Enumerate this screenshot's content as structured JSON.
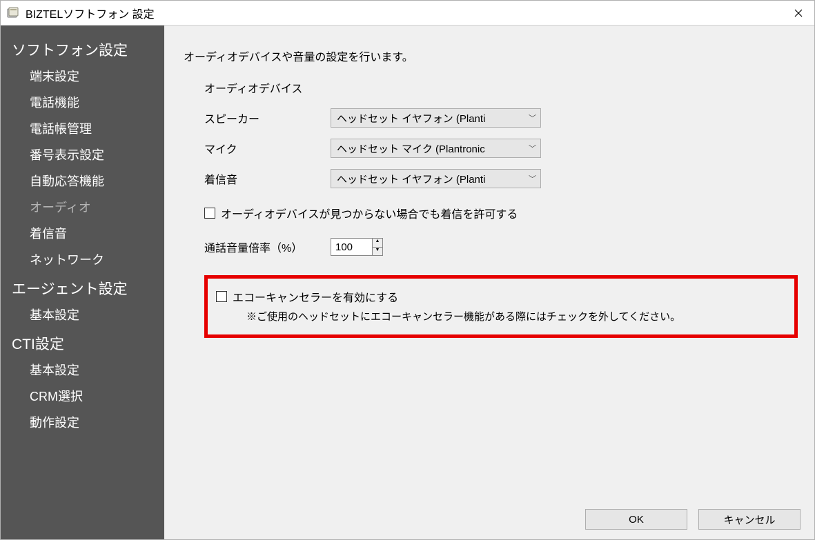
{
  "window": {
    "title": "BIZTELソフトフォン 設定"
  },
  "sidebar": {
    "sections": [
      {
        "title": "ソフトフォン設定",
        "items": [
          {
            "label": "端末設定",
            "active": false
          },
          {
            "label": "電話機能",
            "active": false
          },
          {
            "label": "電話帳管理",
            "active": false
          },
          {
            "label": "番号表示設定",
            "active": false
          },
          {
            "label": "自動応答機能",
            "active": false
          },
          {
            "label": "オーディオ",
            "active": true
          },
          {
            "label": "着信音",
            "active": false
          },
          {
            "label": "ネットワーク",
            "active": false
          }
        ]
      },
      {
        "title": "エージェント設定",
        "items": [
          {
            "label": "基本設定",
            "active": false
          }
        ]
      },
      {
        "title": "CTI設定",
        "items": [
          {
            "label": "基本設定",
            "active": false
          },
          {
            "label": "CRM選択",
            "active": false
          },
          {
            "label": "動作設定",
            "active": false
          }
        ]
      }
    ]
  },
  "main": {
    "heading": "オーディオデバイスや音量の設定を行います。",
    "audio_device_heading": "オーディオデバイス",
    "speaker_label": "スピーカー",
    "speaker_value": "ヘッドセット イヤフォン (Planti",
    "mic_label": "マイク",
    "mic_value": "ヘッドセット マイク (Plantronic",
    "ringtone_label": "着信音",
    "ringtone_value": "ヘッドセット イヤフォン (Planti",
    "allow_no_device_label": "オーディオデバイスが見つからない場合でも着信を許可する",
    "volume_rate_label": "通話音量倍率（%）",
    "volume_rate_value": "100",
    "echo_canceller_label": "エコーキャンセラーを有効にする",
    "echo_canceller_note": "※ご使用のヘッドセットにエコーキャンセラー機能がある際にはチェックを外してください。"
  },
  "footer": {
    "ok_label": "OK",
    "cancel_label": "キャンセル"
  }
}
